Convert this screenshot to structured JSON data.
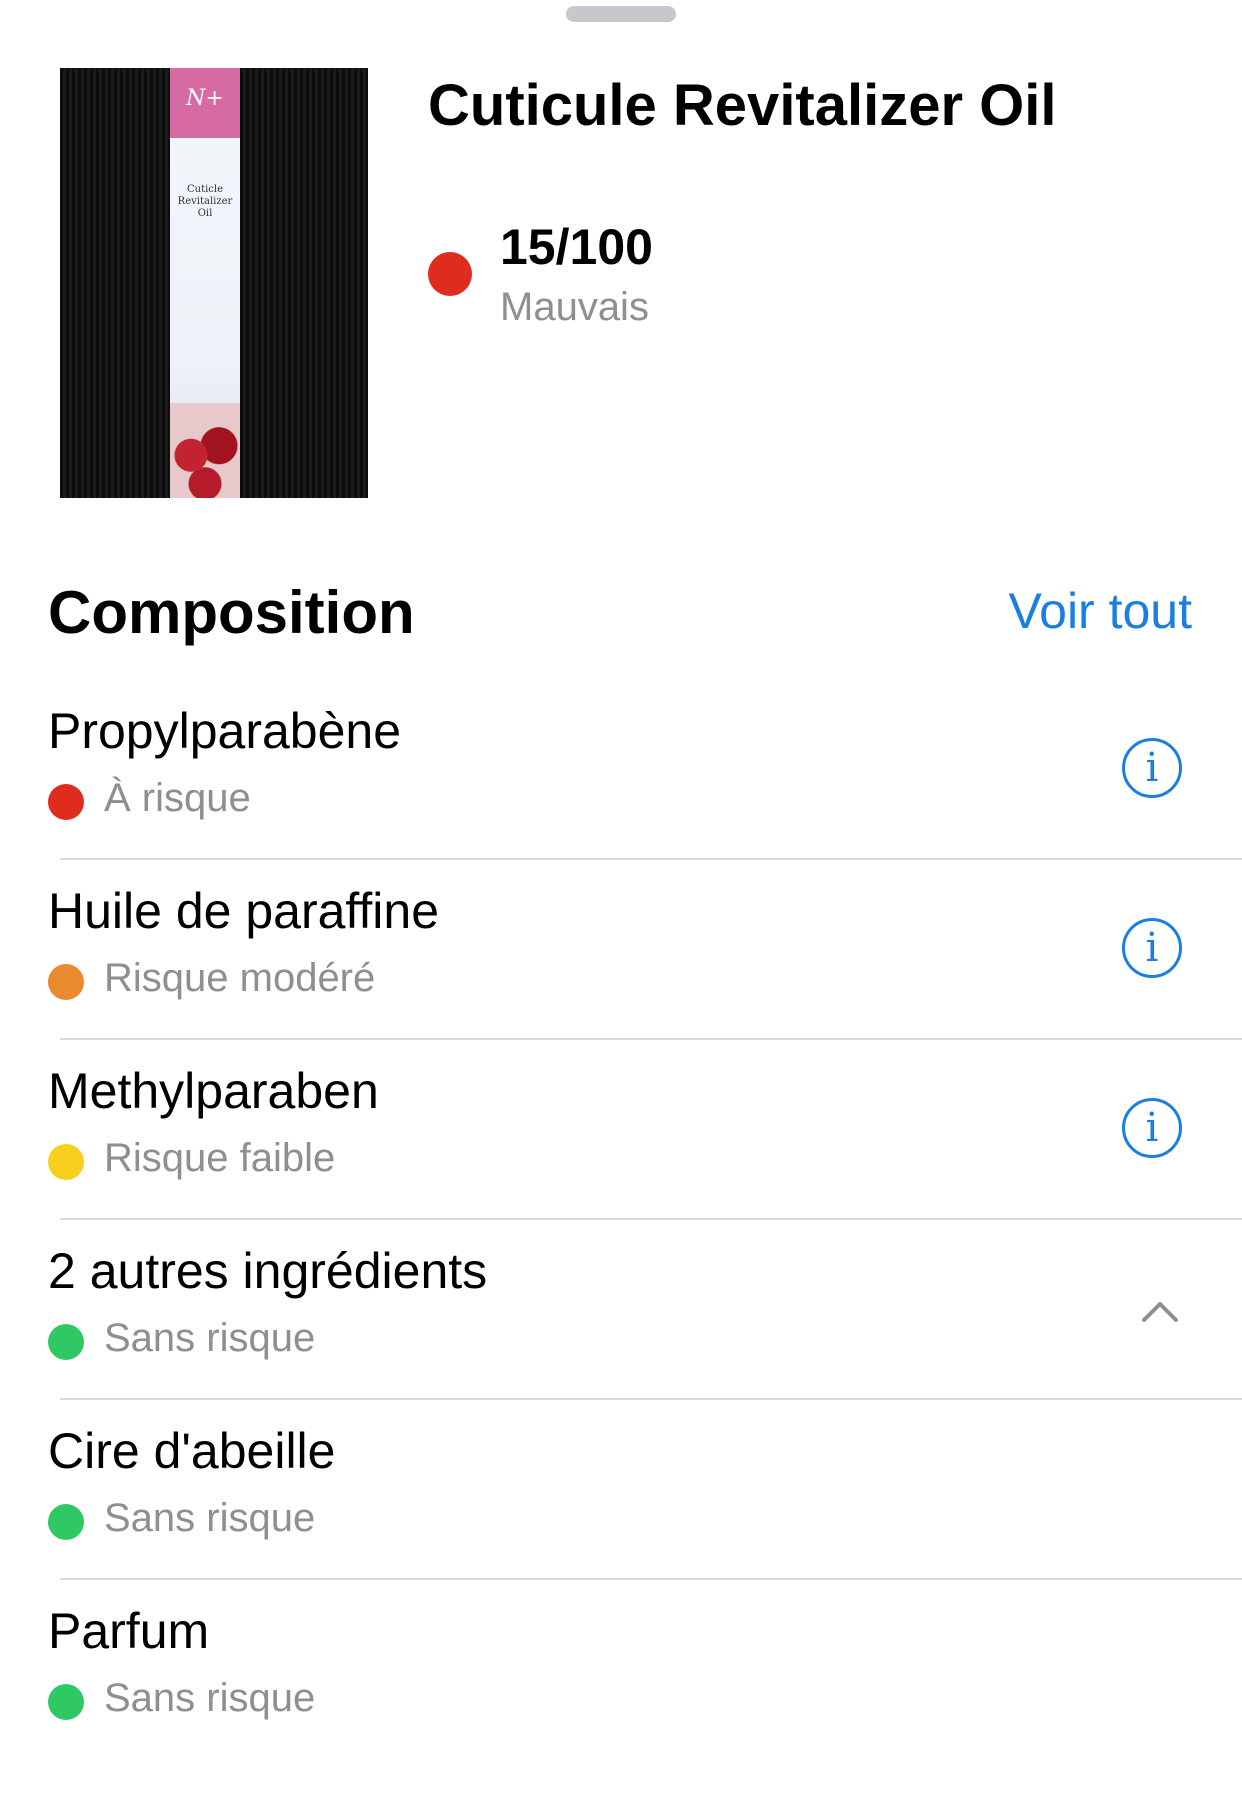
{
  "product": {
    "title": "Cuticule Revitalizer Oil",
    "image_alt": "Cuticle Revitalizer Oil product photo",
    "score": "15/100",
    "rating": "Mauvais",
    "score_color": "#e02c1f"
  },
  "composition": {
    "title": "Composition",
    "see_all": "Voir tout",
    "items": [
      {
        "name": "Propylparabène",
        "risk": "À risque",
        "color": "#e02c1f",
        "action": "info-icon"
      },
      {
        "name": "Huile de paraffine",
        "risk": "Risque modéré",
        "color": "#ea8a2e",
        "action": "info-icon"
      },
      {
        "name": "Methylparaben",
        "risk": "Risque faible",
        "color": "#f7cf1c",
        "action": "info-icon"
      },
      {
        "name": "2 autres ingrédients",
        "risk": "Sans risque",
        "color": "#2fc865",
        "action": "chevron-up-icon"
      },
      {
        "name": "Cire d'abeille",
        "risk": "Sans risque",
        "color": "#2fc865"
      },
      {
        "name": "Parfum",
        "risk": "Sans risque",
        "color": "#2fc865"
      }
    ]
  }
}
